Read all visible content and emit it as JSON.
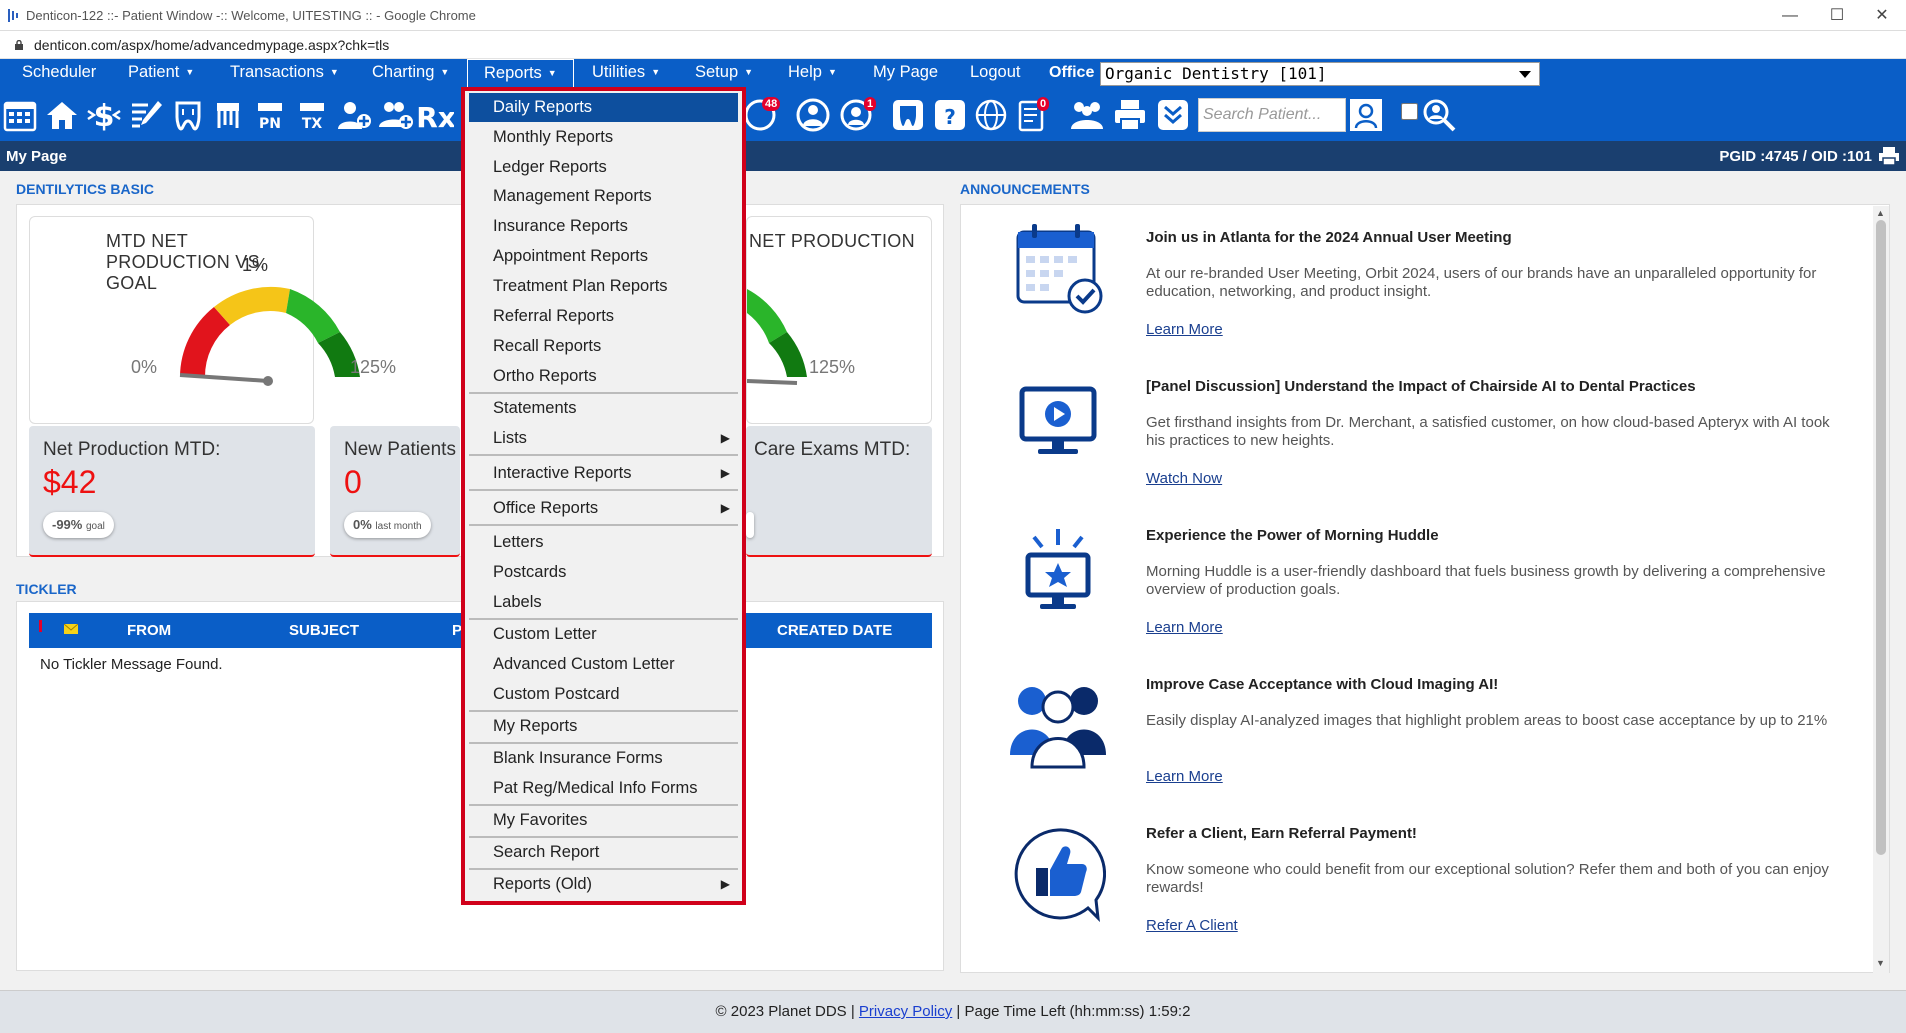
{
  "window": {
    "title": "Denticon-122 ::- Patient Window -:: Welcome, UITESTING :: - Google Chrome",
    "url": "denticon.com/aspx/home/advancedmypage.aspx?chk=tls"
  },
  "menubar": {
    "items": [
      {
        "label": "Scheduler",
        "caret": ""
      },
      {
        "label": "Patient",
        "caret": "▼"
      },
      {
        "label": "Transactions",
        "caret": "▼"
      },
      {
        "label": "Charting",
        "caret": "▼"
      },
      {
        "label": "Reports",
        "caret": "▼"
      },
      {
        "label": "Utilities",
        "caret": "▼"
      },
      {
        "label": "Setup",
        "caret": "▼"
      },
      {
        "label": "Help",
        "caret": "▼"
      },
      {
        "label": "My Page",
        "caret": ""
      },
      {
        "label": "Logout",
        "caret": ""
      }
    ],
    "office_label": "Office",
    "office_value": "Organic Dentistry [101]"
  },
  "toolbar": {
    "badge_messages": "48",
    "badge_alerts": "1",
    "badge_docs": "0",
    "search_placeholder": "Search Patient..."
  },
  "pagebar": {
    "title": "My Page",
    "ids": "PGID :4745  /  OID :101"
  },
  "dentilytics": {
    "section_title": "DENTILYTICS BASIC",
    "gauge1": {
      "title": "MTD NET PRODUCTION VS. GOAL",
      "pct": "1%",
      "min": "0%",
      "max": "125%",
      "value_fraction": 0.01
    },
    "gauge2": {
      "title": "NET PRODUCTION",
      "max": "125%"
    },
    "stats": [
      {
        "label": "Net Production MTD:",
        "value": "$42",
        "pill_value": "-99%",
        "pill_unit": "goal"
      },
      {
        "label": "New Patients",
        "value": "0",
        "pill_value": "0%",
        "pill_unit": "last month"
      },
      {
        "label": "Care Exams MTD:",
        "value": "",
        "pill_value": "",
        "pill_unit": ""
      }
    ]
  },
  "tickler": {
    "section_title": "TICKLER",
    "columns": [
      "FROM",
      "SUBJECT",
      "P",
      "CREATED DATE"
    ],
    "empty_message": "No Tickler Message Found."
  },
  "announcements": {
    "section_title": "ANNOUNCEMENTS",
    "items": [
      {
        "icon": "calendar-check-icon",
        "title": "Join us in Atlanta for the 2024 Annual User Meeting",
        "body": "At our re-branded User Meeting, Orbit 2024, users of our brands have an unparalleled opportunity for education, networking, and product insight.",
        "link": "Learn More"
      },
      {
        "icon": "monitor-play-icon",
        "title": "[Panel Discussion] Understand the Impact of Chairside AI to Dental Practices",
        "body": "Get firsthand insights from Dr. Merchant, a satisfied customer, on how cloud-based Apteryx with AI took his practices to new heights.",
        "link": "Watch Now"
      },
      {
        "icon": "monitor-star-icon",
        "title": "Experience the Power of Morning Huddle",
        "body": "Morning Huddle is a user-friendly dashboard that fuels business growth by delivering a comprehensive overview of production goals.",
        "link": "Learn More"
      },
      {
        "icon": "people-group-icon",
        "title": "Improve Case Acceptance with Cloud Imaging AI!",
        "body": "Easily display AI-analyzed images that highlight problem areas to boost case acceptance by up to 21%",
        "link": "Learn More"
      },
      {
        "icon": "thumbs-up-icon",
        "title": "Refer a Client, Earn Referral Payment!",
        "body": "Know someone who could benefit from our exceptional solution? Refer them and both of you can enjoy rewards!",
        "link": "Refer A Client"
      }
    ]
  },
  "footer": {
    "copyright": "© 2023 Planet DDS | ",
    "privacy": "Privacy Policy",
    "time_left": " |  Page Time Left (hh:mm:ss) 1:59:2"
  },
  "reports_menu": {
    "items": [
      {
        "label": "Daily Reports",
        "sub": ""
      },
      {
        "label": "Monthly Reports",
        "sub": ""
      },
      {
        "label": "Ledger Reports",
        "sub": ""
      },
      {
        "label": "Management Reports",
        "sub": ""
      },
      {
        "label": "Insurance Reports",
        "sub": ""
      },
      {
        "label": "Appointment Reports",
        "sub": ""
      },
      {
        "label": "Treatment Plan Reports",
        "sub": ""
      },
      {
        "label": "Referral Reports",
        "sub": ""
      },
      {
        "label": "Recall Reports",
        "sub": ""
      },
      {
        "label": "Ortho Reports",
        "sub": ""
      },
      {
        "label": "Statements",
        "sub": ""
      },
      {
        "label": "Lists",
        "sub": "▶"
      },
      {
        "label": "Interactive Reports",
        "sub": "▶"
      },
      {
        "label": "Office Reports",
        "sub": "▶"
      },
      {
        "label": "Letters",
        "sub": ""
      },
      {
        "label": "Postcards",
        "sub": ""
      },
      {
        "label": "Labels",
        "sub": ""
      },
      {
        "label": "Custom Letter",
        "sub": ""
      },
      {
        "label": "Advanced Custom Letter",
        "sub": ""
      },
      {
        "label": "Custom Postcard",
        "sub": ""
      },
      {
        "label": "My Reports",
        "sub": ""
      },
      {
        "label": "Blank Insurance Forms",
        "sub": ""
      },
      {
        "label": "Pat Reg/Medical Info Forms",
        "sub": ""
      },
      {
        "label": "My Favorites",
        "sub": ""
      },
      {
        "label": "Search Report",
        "sub": ""
      },
      {
        "label": "Reports (Old)",
        "sub": "▶"
      }
    ]
  },
  "colors": {
    "brand_blue": "#0a5ec7",
    "navy": "#1a3f6f",
    "alert_red": "#e11111",
    "menu_highlight": "#0d4f9e",
    "dropdown_border": "#d0001a"
  }
}
